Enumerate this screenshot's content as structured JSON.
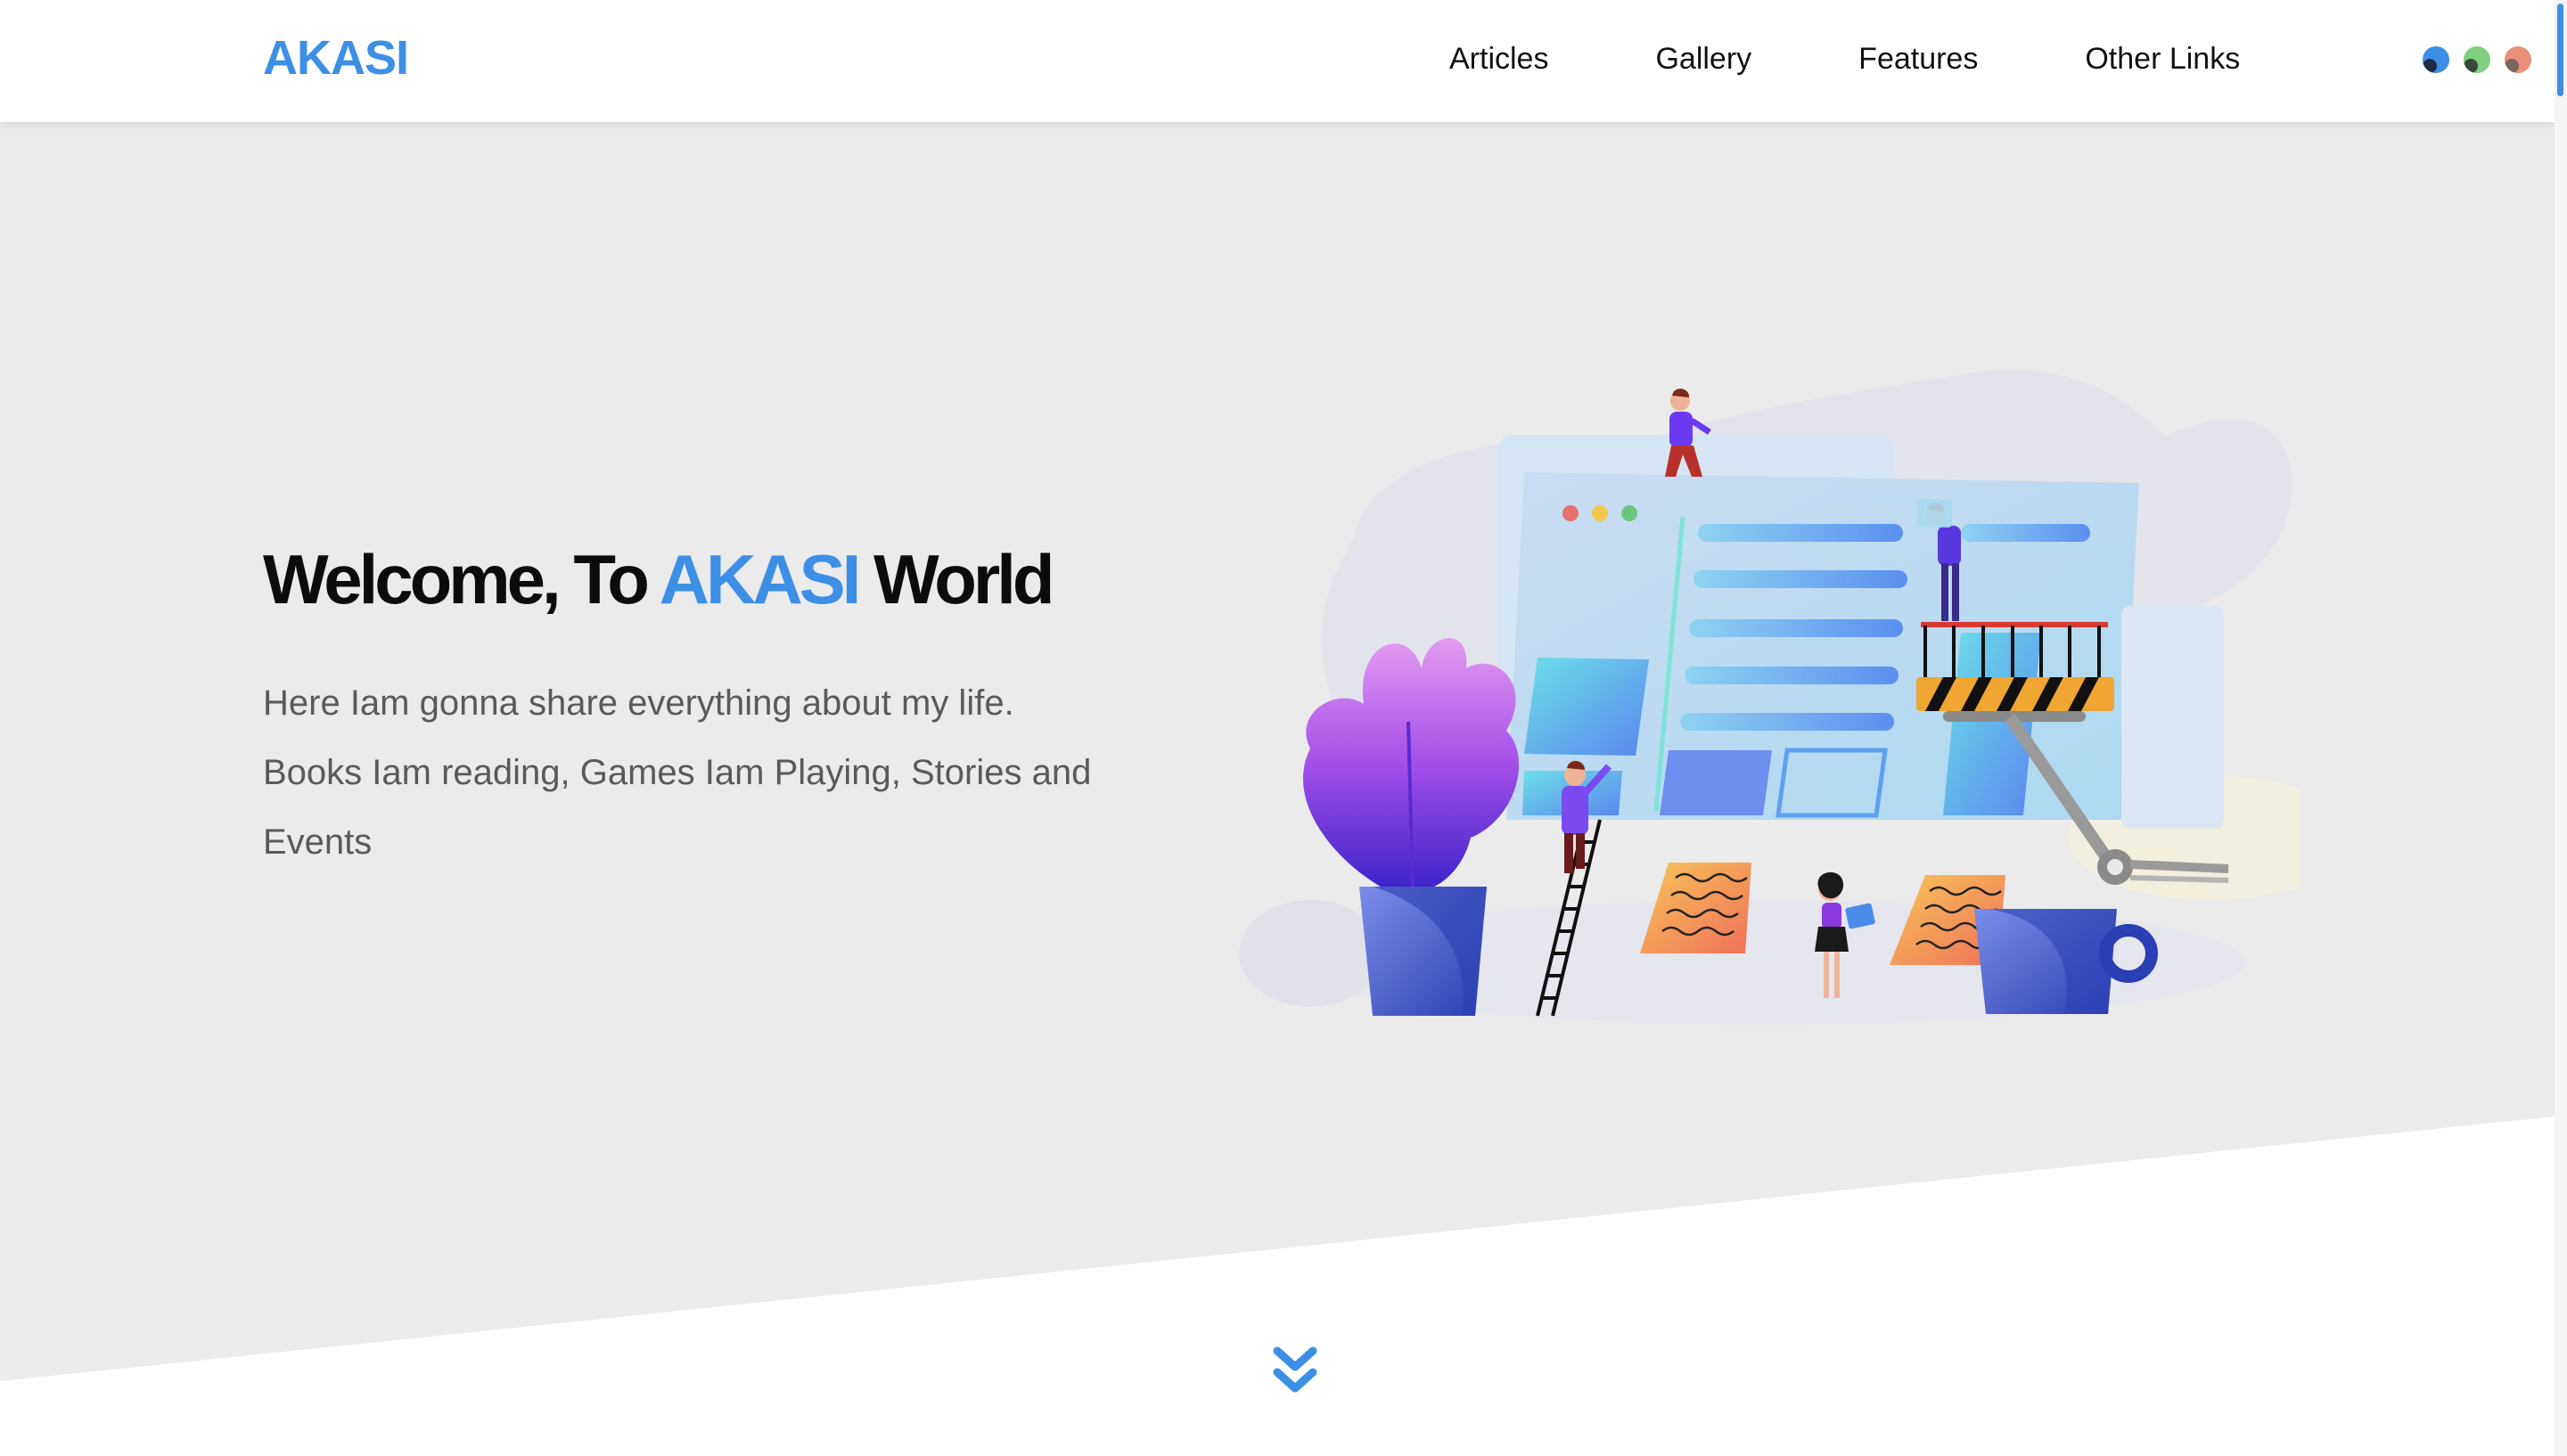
{
  "header": {
    "brand": "AKASI",
    "nav": [
      {
        "label": "Articles"
      },
      {
        "label": "Gallery"
      },
      {
        "label": "Features"
      },
      {
        "label": "Other Links"
      }
    ],
    "theme_options": [
      {
        "name": "blue-theme",
        "color": "#3d8fe6",
        "inner_color": "#1f2a44"
      },
      {
        "name": "green-theme",
        "color": "#7fd07f",
        "inner_color": "#3a4a3a"
      },
      {
        "name": "coral-theme",
        "color": "#e8907a",
        "inner_color": "#7a6660"
      }
    ]
  },
  "hero": {
    "title_prefix": "Welcome, To ",
    "title_accent": "AKASI",
    "title_suffix": " World",
    "description_line1": "Here Iam gonna share everything about my life.",
    "description_line2": "Books Iam reading, Games Iam Playing, Stories and",
    "description_line3": "Events"
  },
  "colors": {
    "accent": "#3d8fe6",
    "hero_background": "#ebebeb",
    "text_dark": "#0c0c0c",
    "text_muted": "#5a5a5a"
  },
  "icons": {
    "scroll_down": "double-chevron-down-icon"
  }
}
